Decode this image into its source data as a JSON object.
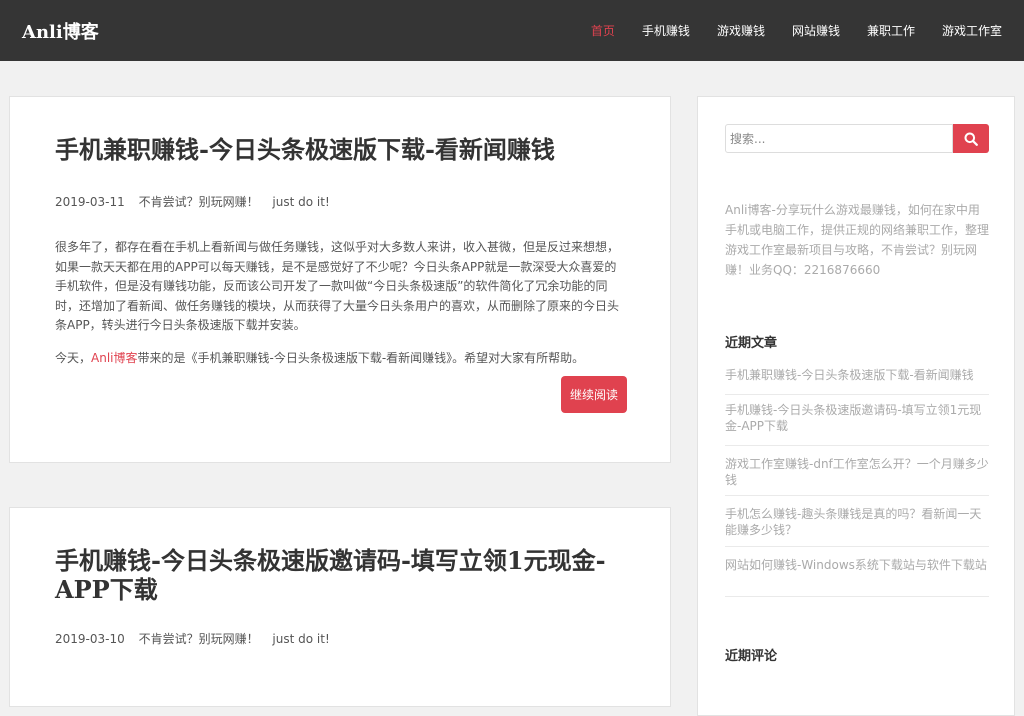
{
  "header": {
    "logo": "Anli博客",
    "nav": [
      {
        "label": "首页",
        "active": true
      },
      {
        "label": "手机赚钱",
        "active": false
      },
      {
        "label": "游戏赚钱",
        "active": false
      },
      {
        "label": "网站赚钱",
        "active": false
      },
      {
        "label": "兼职工作",
        "active": false
      },
      {
        "label": "游戏工作室",
        "active": false
      }
    ]
  },
  "posts": [
    {
      "title": "手机兼职赚钱-今日头条极速版下载-看新闻赚钱",
      "date": "2019-03-11",
      "tag1": "不肯尝试？别玩网赚！",
      "tag2": "just do it!",
      "excerpt": "很多年了，都存在看在手机上看新闻与做任务赚钱，这似乎对大多数人来讲，收入甚微，但是反过来想想，如果一款天天都在用的APP可以每天赚钱，是不是感觉好了不少呢？今日头条APP就是一款深受大众喜爱的手机软件，但是没有赚钱功能，反而该公司开发了一款叫做“今日头条极速版”的软件简化了冗余功能的同时，还增加了看新闻、做任务赚钱的模块，从而获得了大量今日头条用户的喜欢，从而删除了原来的今日头条APP，转头进行今日头条极速版下载并安装。",
      "intro_prefix": "今天，",
      "intro_brand": "Anli博客",
      "intro_suffix": "带来的是《手机兼职赚钱-今日头条极速版下载-看新闻赚钱》。希望对大家有所帮助。",
      "read_more": "继续阅读"
    },
    {
      "title": "手机赚钱-今日头条极速版邀请码-填写立领1元现金-APP下载",
      "date": "2019-03-10",
      "tag1": "不肯尝试？别玩网赚！",
      "tag2": "just do it!"
    }
  ],
  "sidebar": {
    "search_placeholder": "搜索...",
    "about": "Anli博客-分享玩什么游戏最赚钱，如何在家中用手机或电脑工作，提供正规的网络兼职工作，整理游戏工作室最新项目与攻略，不肯尝试？别玩网赚！业务QQ：2216876660",
    "recent_title": "近期文章",
    "recent_posts": [
      "手机兼职赚钱-今日头条极速版下载-看新闻赚钱",
      "手机赚钱-今日头条极速版邀请码-填写立领1元现金-APP下载",
      "游戏工作室赚钱-dnf工作室怎么开？一个月赚多少钱",
      "手机怎么赚钱-趣头条赚钱是真的吗？看新闻一天能赚多少钱？",
      "网站如何赚钱-Windows系统下载站与软件下载站"
    ],
    "comments_title": "近期评论"
  },
  "colors": {
    "accent": "#e0424f",
    "header_bg": "#353535",
    "page_bg": "#f1f1f1"
  },
  "icons": {
    "search_button": "search-icon"
  }
}
